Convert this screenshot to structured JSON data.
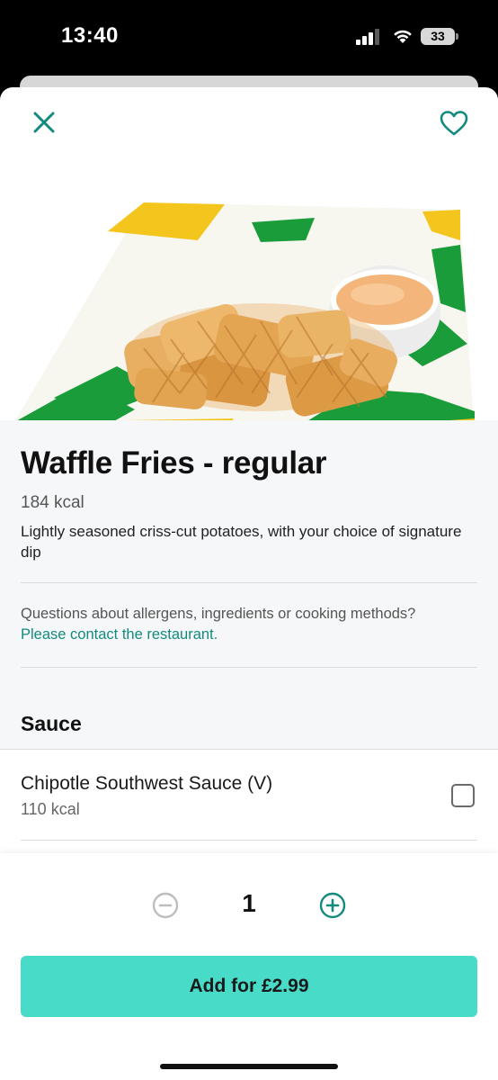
{
  "status_bar": {
    "time": "13:40",
    "battery": "33"
  },
  "product": {
    "title": "Waffle Fries - regular",
    "kcal": "184 kcal",
    "description": "Lightly seasoned criss-cut potatoes, with your choice of signature dip",
    "image_icon": "waffle-fries-image"
  },
  "allergens": {
    "question": "Questions about allergens, ingredients or cooking methods?",
    "link": "Please contact the restaurant."
  },
  "sauce_section": {
    "title": "Sauce",
    "options": [
      {
        "name": "Chipotle Southwest Sauce (V)",
        "kcal": "110 kcal",
        "checked": false
      }
    ]
  },
  "quantity": {
    "value": "1"
  },
  "add_button": {
    "label": "Add for £2.99"
  },
  "colors": {
    "accent": "#138a7e",
    "button": "#48dcc8",
    "brand_green": "#1a9c3a",
    "brand_yellow": "#f4c51c"
  },
  "icons": [
    "close-icon",
    "heart-icon",
    "minus-circle-icon",
    "plus-circle-icon",
    "checkbox-icon"
  ]
}
